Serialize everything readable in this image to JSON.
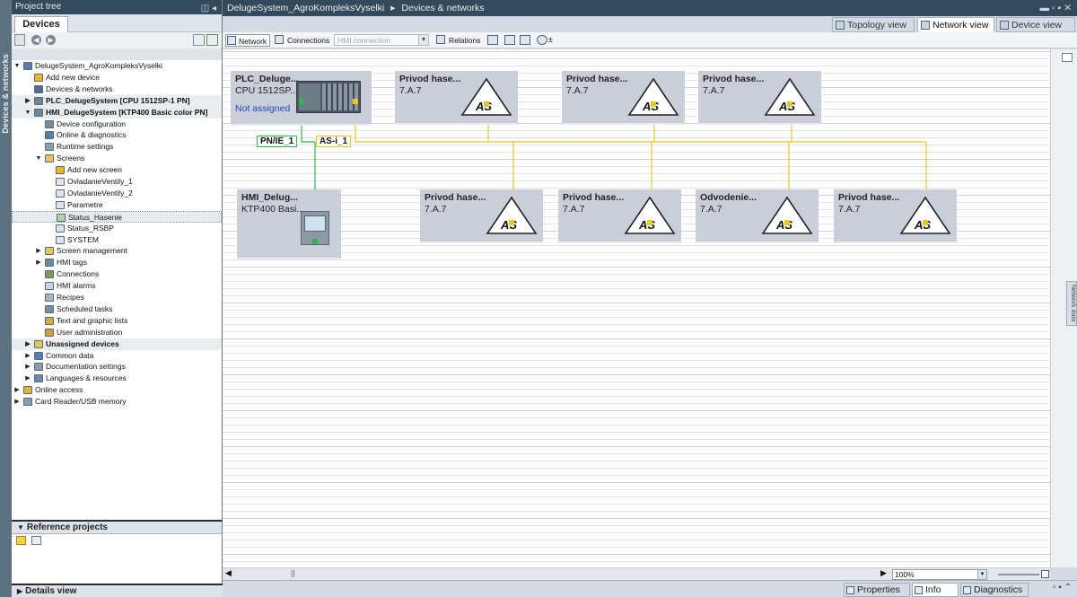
{
  "side_strip": {
    "label": "Devices & networks"
  },
  "project_tree": {
    "header": "Project tree",
    "tab": "Devices",
    "items": [
      {
        "label": "DelugeSystem_AgroKompleksVyselki",
        "arrow": "▼",
        "icon": "project-icon"
      },
      {
        "label": "Add new device",
        "arrow": "",
        "icon": "add-device-icon"
      },
      {
        "label": "Devices & networks",
        "arrow": "",
        "icon": "network-icon"
      },
      {
        "label": "PLC_DelugeSystem [CPU 1512SP-1 PN]",
        "arrow": "▶",
        "icon": "plc-icon"
      },
      {
        "label": "HMI_DelugeSystem [KTP400 Basic color PN]",
        "arrow": "▼",
        "icon": "hmi-icon"
      },
      {
        "label": "Device configuration",
        "arrow": "",
        "icon": "device-config-icon"
      },
      {
        "label": "Online & diagnostics",
        "arrow": "",
        "icon": "diagnostics-icon"
      },
      {
        "label": "Runtime settings",
        "arrow": "",
        "icon": "settings-icon"
      },
      {
        "label": "Screens",
        "arrow": "▼",
        "icon": "folder-icon"
      },
      {
        "label": "Add new screen",
        "arrow": "",
        "icon": "add-screen-icon"
      },
      {
        "label": "OvladanieVentily_1",
        "arrow": "",
        "icon": "screen-icon"
      },
      {
        "label": "OvladanieVentily_2",
        "arrow": "",
        "icon": "screen-icon"
      },
      {
        "label": "Parametre",
        "arrow": "",
        "icon": "screen-icon"
      },
      {
        "label": "Status_Hasenie",
        "arrow": "",
        "icon": "screen-start-icon"
      },
      {
        "label": "Status_RSBP",
        "arrow": "",
        "icon": "screen-icon"
      },
      {
        "label": "SYSTEM",
        "arrow": "",
        "icon": "screen-icon"
      },
      {
        "label": "Screen management",
        "arrow": "▶",
        "icon": "folder-icon"
      },
      {
        "label": "HMI tags",
        "arrow": "▶",
        "icon": "tags-icon"
      },
      {
        "label": "Connections",
        "arrow": "",
        "icon": "connections-icon"
      },
      {
        "label": "HMI alarms",
        "arrow": "",
        "icon": "alarms-icon"
      },
      {
        "label": "Recipes",
        "arrow": "",
        "icon": "recipes-icon"
      },
      {
        "label": "Scheduled tasks",
        "arrow": "",
        "icon": "tasks-icon"
      },
      {
        "label": "Text and graphic lists",
        "arrow": "",
        "icon": "lists-icon"
      },
      {
        "label": "User administration",
        "arrow": "",
        "icon": "users-icon"
      },
      {
        "label": "Unassigned devices",
        "arrow": "▶",
        "icon": "folder-icon"
      },
      {
        "label": "Common data",
        "arrow": "▶",
        "icon": "common-data-icon"
      },
      {
        "label": "Documentation settings",
        "arrow": "▶",
        "icon": "documentation-icon"
      },
      {
        "label": "Languages & resources",
        "arrow": "▶",
        "icon": "languages-icon"
      },
      {
        "label": "Online access",
        "arrow": "▶",
        "icon": "online-icon"
      },
      {
        "label": "Card Reader/USB memory",
        "arrow": "▶",
        "icon": "card-reader-icon"
      }
    ],
    "reference_projects": "Reference projects",
    "details_view": "Details view"
  },
  "main": {
    "breadcrumb_project": "DelugeSystem_AgroKompleksVyselki",
    "breadcrumb_sep": "▸",
    "breadcrumb_page": "Devices & networks",
    "view_tabs": {
      "topology": "Topology view",
      "network": "Network view",
      "device": "Device view"
    },
    "toolbar": {
      "network": "Network",
      "connections": "Connections",
      "hmi_connection": "HMI connection",
      "relations": "Relations"
    },
    "zoom": "100%",
    "right_tab": "Network data"
  },
  "network": {
    "plc": {
      "name": "PLC_Deluge...",
      "type": "CPU 1512SP...",
      "status": "Not assigned"
    },
    "hmi": {
      "name": "HMI_Delug...",
      "type": "KTP400 Basi..."
    },
    "labels": {
      "profinet": "PN/IE_1",
      "asi": "AS-i_1"
    },
    "asi_devices": [
      {
        "name": "Privod hase...",
        "version": "7.A.7"
      },
      {
        "name": "Privod hase...",
        "version": "7.A.7"
      },
      {
        "name": "Privod hase...",
        "version": "7.A.7"
      },
      {
        "name": "Privod hase...",
        "version": "7.A.7"
      },
      {
        "name": "Privod hase...",
        "version": "7.A.7"
      },
      {
        "name": "Odvodenie...",
        "version": "7.A.7"
      },
      {
        "name": "Privod hase...",
        "version": "7.A.7"
      }
    ],
    "colors": {
      "profinet": "#2fb34a",
      "asi": "#e8c81e",
      "device_bg": "#c9ced9"
    }
  },
  "bottom_tabs": {
    "properties": "Properties",
    "info": "Info",
    "diagnostics": "Diagnostics"
  }
}
